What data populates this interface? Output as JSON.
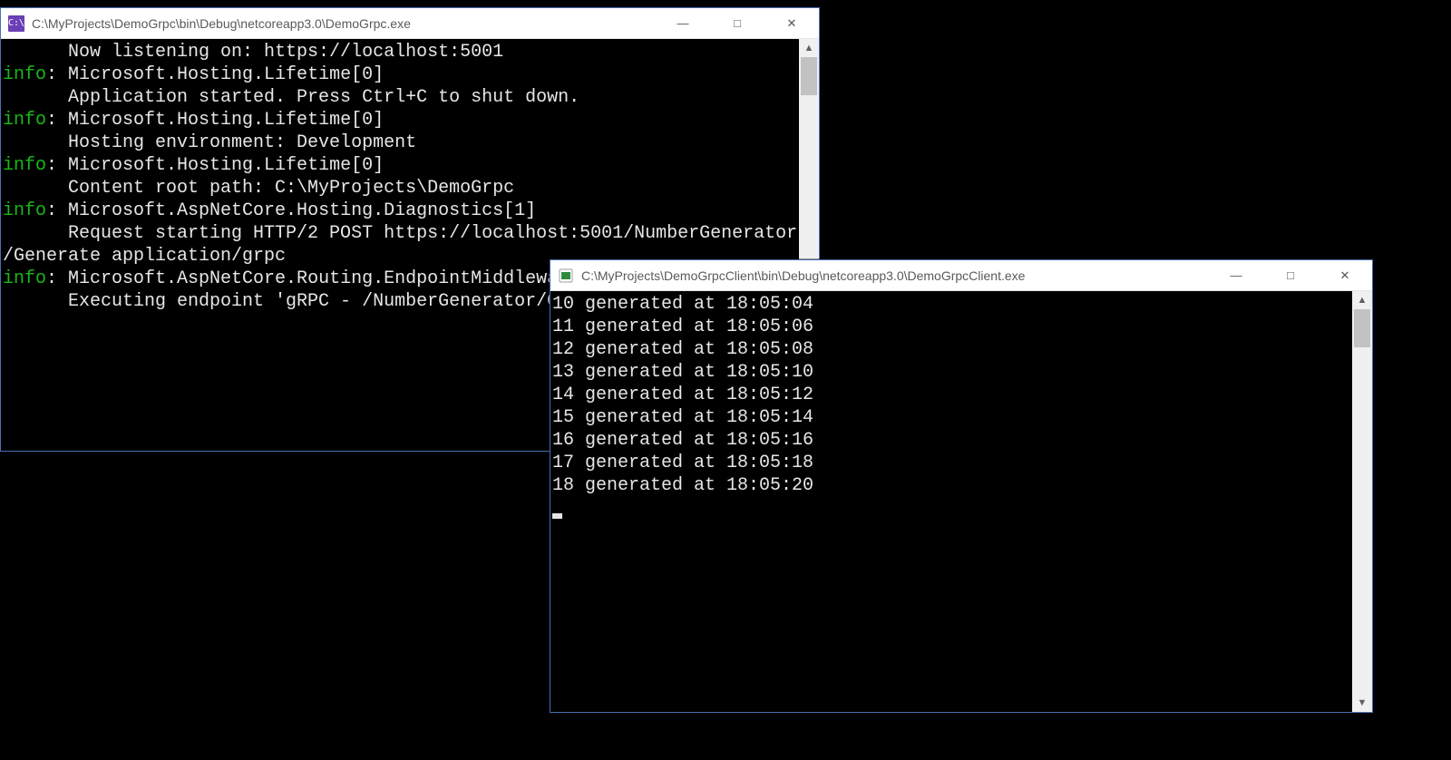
{
  "server_window": {
    "title": "C:\\MyProjects\\DemoGrpc\\bin\\Debug\\netcoreapp3.0\\DemoGrpc.exe",
    "app_icon_text": "C:\\",
    "lines": [
      {
        "prefix": "",
        "text": "      Now listening on: https://localhost:5001"
      },
      {
        "prefix": "info",
        "text": ": Microsoft.Hosting.Lifetime[0]"
      },
      {
        "prefix": "",
        "text": "      Application started. Press Ctrl+C to shut down."
      },
      {
        "prefix": "info",
        "text": ": Microsoft.Hosting.Lifetime[0]"
      },
      {
        "prefix": "",
        "text": "      Hosting environment: Development"
      },
      {
        "prefix": "info",
        "text": ": Microsoft.Hosting.Lifetime[0]"
      },
      {
        "prefix": "",
        "text": "      Content root path: C:\\MyProjects\\DemoGrpc"
      },
      {
        "prefix": "info",
        "text": ": Microsoft.AspNetCore.Hosting.Diagnostics[1]"
      },
      {
        "prefix": "",
        "text": "      Request starting HTTP/2 POST https://localhost:5001/NumberGenerator"
      },
      {
        "prefix": "",
        "text": "/Generate application/grpc"
      },
      {
        "prefix": "info",
        "text": ": Microsoft.AspNetCore.Routing.EndpointMiddlewa"
      },
      {
        "prefix": "",
        "text": "      Executing endpoint 'gRPC - /NumberGenerator/G"
      }
    ]
  },
  "client_window": {
    "title": "C:\\MyProjects\\DemoGrpcClient\\bin\\Debug\\netcoreapp3.0\\DemoGrpcClient.exe",
    "lines": [
      "10 generated at 18:05:04",
      "11 generated at 18:05:06",
      "12 generated at 18:05:08",
      "13 generated at 18:05:10",
      "14 generated at 18:05:12",
      "15 generated at 18:05:14",
      "16 generated at 18:05:16",
      "17 generated at 18:05:18",
      "18 generated at 18:05:20"
    ]
  },
  "controls": {
    "minimize": "—",
    "maximize": "□",
    "close": "✕"
  }
}
